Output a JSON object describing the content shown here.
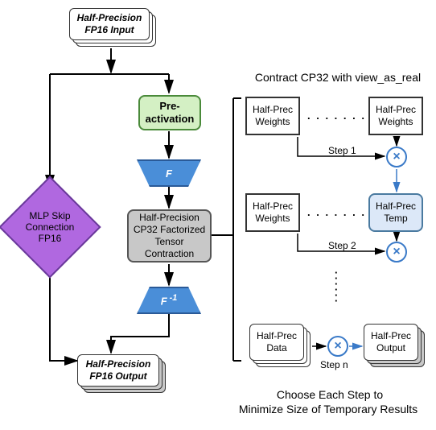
{
  "title_top": "Half-Precision FP16 Input",
  "title_bottom": "Half-Precision FP16 Output",
  "pre_activation": "Pre-activation",
  "F": "F",
  "Finv": "F",
  "Finv_sup": " -1",
  "contraction": "Half-Precision CP32 Factorized Tensor Contraction",
  "mlp_skip": "MLP Skip Connection FP16",
  "right_title": "Contract CP32 with view_as_real",
  "wbox": "Half-Prec Weights",
  "tempbox": "Half-Prec Temp",
  "databox": "Half-Prec Data",
  "outbox": "Half-Prec Output",
  "step1": "Step 1",
  "step2": "Step 2",
  "stepn": "Step n",
  "footer1": "Choose Each Step to",
  "footer2": "Minimize Size of Temporary Results",
  "dots_h": ". . . . . . .",
  "dots_v": "·\n·\n·\n·",
  "mult": "×"
}
